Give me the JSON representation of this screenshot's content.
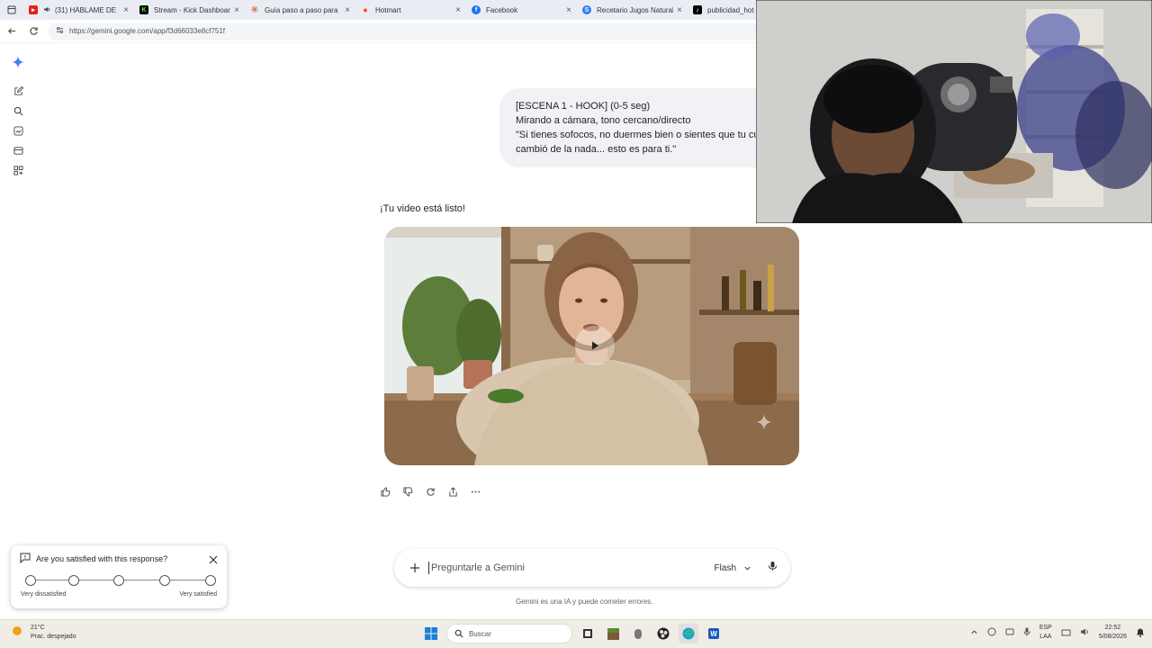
{
  "tabs": [
    {
      "title": "(31) HÁBLAME DE",
      "favicon": "youtube-icon",
      "color": "#e62117"
    },
    {
      "title": "Stream - Kick Dashboard",
      "favicon": "kick-icon",
      "color": "#53fc18"
    },
    {
      "title": "Guía paso a paso para",
      "favicon": "claude-icon",
      "color": "#d97757"
    },
    {
      "title": "Hotmart",
      "favicon": "hotmart-icon",
      "color": "#f04e23"
    },
    {
      "title": "Facebook",
      "favicon": "facebook-icon",
      "color": "#1877f2"
    },
    {
      "title": "Recetario Jugos Natural",
      "favicon": "web-icon",
      "color": "#2b7de9"
    },
    {
      "title": "publicidad_hot",
      "favicon": "tiktok-icon",
      "color": "#000000"
    }
  ],
  "address": {
    "url": "https://gemini.google.com/app/f3d66033e8cf751f"
  },
  "prompt": {
    "lines": [
      "[ESCENA 1 - HOOK] (0-5 seg)",
      "Mirando a cámara, tono cercano/directo",
      "\"Si tienes sofocos, no duermes bien o sientes que tu cu",
      "cambió de la nada... esto es para ti.\""
    ]
  },
  "response": {
    "ready_text": "¡Tu video está listo!"
  },
  "composer": {
    "placeholder": "Preguntarle a Gemini",
    "model": "Flash",
    "disclaimer": "Gemini es una IA y puede cometer errores."
  },
  "survey": {
    "question": "Are you satisfied with this response?",
    "low_label": "Very dissatisfied",
    "high_label": "Very satisfied",
    "options": 5
  },
  "taskbar": {
    "weather_temp": "21°C",
    "weather_desc": "Prac. despejado",
    "search_placeholder": "Buscar",
    "lang_top": "ESP",
    "lang_bottom": "LAA",
    "time": "22:52",
    "date": "5/08/2026"
  },
  "colors": {
    "accent": "#1a73e8",
    "bubble": "#f0f2f5"
  }
}
